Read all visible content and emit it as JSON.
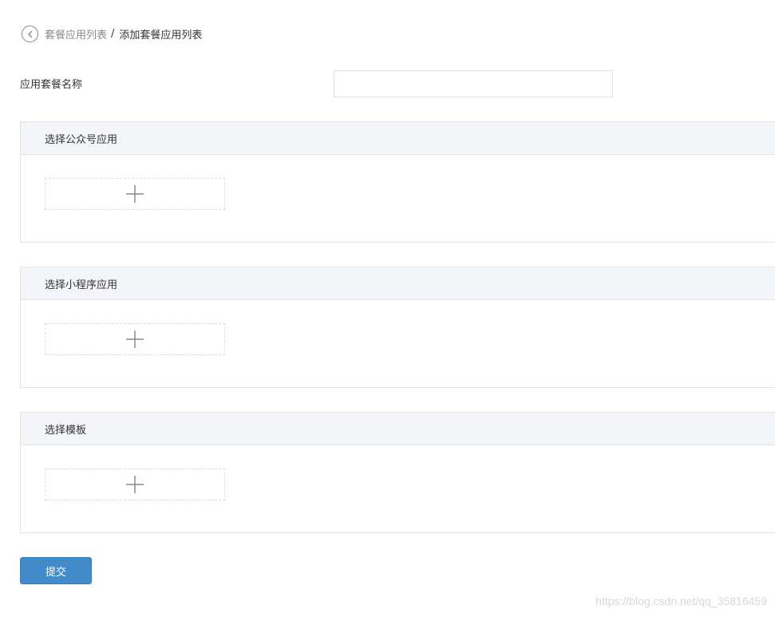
{
  "breadcrumb": {
    "parent": "套餐应用列表",
    "separator": "/",
    "current": "添加套餐应用列表"
  },
  "form": {
    "name_label": "应用套餐名称",
    "name_value": "",
    "name_placeholder": ""
  },
  "panels": [
    {
      "title": "选择公众号应用",
      "add_icon": "plus-icon"
    },
    {
      "title": "选择小程序应用",
      "add_icon": "plus-icon"
    },
    {
      "title": "选择模板",
      "add_icon": "plus-icon"
    }
  ],
  "submit_label": "提交",
  "watermark": "https://blog.csdn.net/qq_35816459",
  "colors": {
    "primary": "#428bca",
    "panel_header_bg": "#f4f5f9",
    "border": "#e4e4e4",
    "muted_text": "#8a8a8a"
  }
}
